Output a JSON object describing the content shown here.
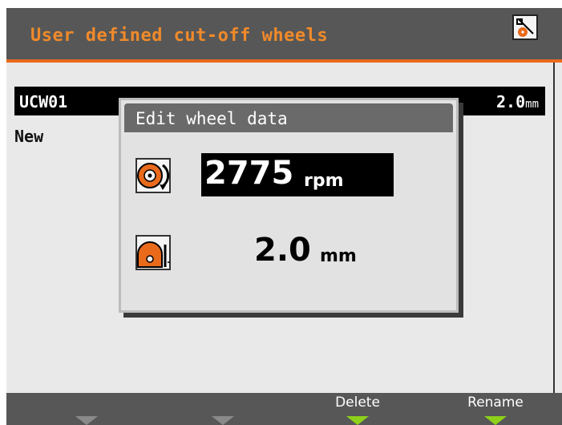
{
  "header": {
    "title": "User defined cut-off wheels",
    "corner_icon": "wheel-settings-icon",
    "accent_color": "#ea6a1c"
  },
  "list": {
    "selected": {
      "name": "UCW01",
      "value": "2.0",
      "unit": "mm"
    },
    "items": [
      {
        "name": "New"
      }
    ]
  },
  "dialog": {
    "title": "Edit wheel data",
    "speed": {
      "icon": "wheel-speed-icon",
      "value": "2775",
      "unit": "rpm"
    },
    "thickness": {
      "icon": "wheel-thickness-icon",
      "value": "2.0",
      "unit": "mm"
    }
  },
  "footer": {
    "softkeys": [
      {
        "label": "",
        "active": false
      },
      {
        "label": "",
        "active": false
      },
      {
        "label": "Delete",
        "active": true
      },
      {
        "label": "Rename",
        "active": true
      }
    ],
    "active_color": "#8ed11a"
  }
}
